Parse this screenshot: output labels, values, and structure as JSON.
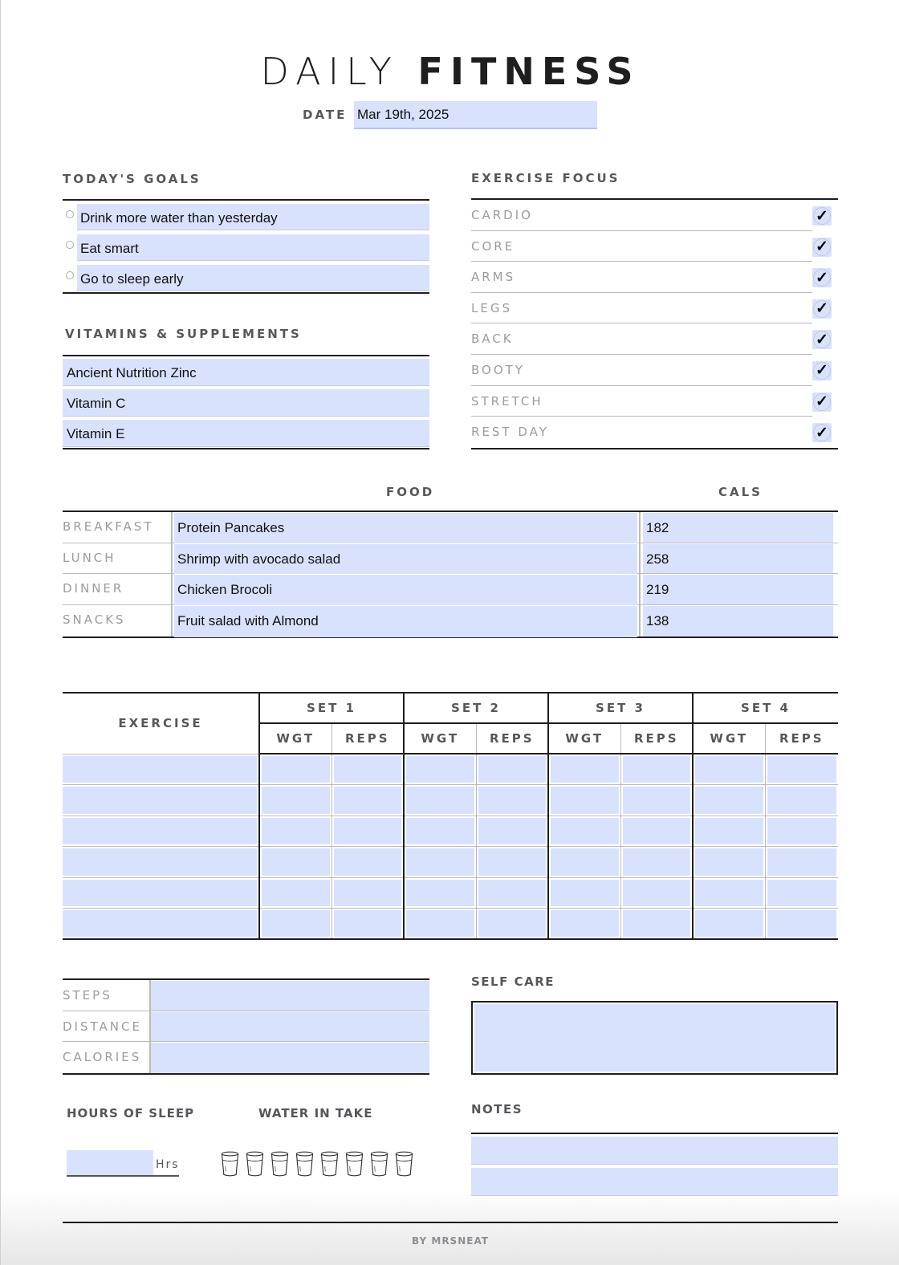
{
  "header": {
    "title_light": "DAILY",
    "title_bold": "FITNESS",
    "date_label": "DATE :",
    "date_value": "Mar 19th, 2025"
  },
  "goals": {
    "title": "TODAY'S GOALS",
    "items": [
      "Drink more water than yesterday",
      "Eat smart",
      "Go to sleep early"
    ]
  },
  "vitamins": {
    "title": "VITAMINS & SUPPLEMENTS",
    "items": [
      "Ancient Nutrition Zinc",
      "Vitamin C",
      "Vitamin E"
    ]
  },
  "exercise_focus": {
    "title": "EXERCISE FOCUS",
    "items": [
      {
        "label": "CARDIO",
        "checked": true,
        "mark": "✓"
      },
      {
        "label": "CORE",
        "checked": true,
        "mark": "✓"
      },
      {
        "label": "ARMS",
        "checked": true,
        "mark": "✓"
      },
      {
        "label": "LEGS",
        "checked": true,
        "mark": "✓"
      },
      {
        "label": "BACK",
        "checked": true,
        "mark": "✓"
      },
      {
        "label": "BOOTY",
        "checked": true,
        "mark": "✓"
      },
      {
        "label": "STRETCH",
        "checked": true,
        "mark": "✓"
      },
      {
        "label": "REST DAY",
        "checked": true,
        "mark": "✓"
      }
    ]
  },
  "food": {
    "food_header": "FOOD",
    "cals_header": "CALS",
    "rows": [
      {
        "meal": "BREAKFAST",
        "food": "Protein Pancakes",
        "cals": "182"
      },
      {
        "meal": "LUNCH",
        "food": "Shrimp with avocado salad",
        "cals": "258"
      },
      {
        "meal": "DINNER",
        "food": "Chicken Brocoli",
        "cals": "219"
      },
      {
        "meal": "SNACKS",
        "food": "Fruit salad with Almond",
        "cals": "138"
      }
    ]
  },
  "workout": {
    "exercise_header": "EXERCISE",
    "sets": [
      "SET 1",
      "SET 2",
      "SET 3",
      "SET 4"
    ],
    "wgt_label": "WGT",
    "reps_label": "REPS",
    "rows": [
      [
        "",
        "",
        "",
        "",
        "",
        "",
        "",
        "",
        ""
      ],
      [
        "",
        "",
        "",
        "",
        "",
        "",
        "",
        "",
        ""
      ],
      [
        "",
        "",
        "",
        "",
        "",
        "",
        "",
        "",
        ""
      ],
      [
        "",
        "",
        "",
        "",
        "",
        "",
        "",
        "",
        ""
      ],
      [
        "",
        "",
        "",
        "",
        "",
        "",
        "",
        "",
        ""
      ],
      [
        "",
        "",
        "",
        "",
        "",
        "",
        "",
        "",
        ""
      ]
    ]
  },
  "stats": {
    "rows": [
      {
        "label": "STEPS",
        "value": ""
      },
      {
        "label": "DISTANCE",
        "value": ""
      },
      {
        "label": "CALORIES",
        "value": ""
      }
    ]
  },
  "self_care": {
    "title": "SELF CARE",
    "value": ""
  },
  "sleep": {
    "title": "HOURS OF SLEEP",
    "value": "",
    "unit": "Hrs"
  },
  "water": {
    "title": "WATER IN TAKE",
    "glasses": 8,
    "icon": "water-glass-icon"
  },
  "notes": {
    "title": "NOTES",
    "lines": [
      "",
      ""
    ]
  },
  "colors": {
    "field_fill": "#d9e2fc",
    "rule": "#1e1e1e",
    "heading": "#55575c",
    "label": "#9a9ca2"
  },
  "footer": {
    "credit": "BY MRSNEAT"
  }
}
